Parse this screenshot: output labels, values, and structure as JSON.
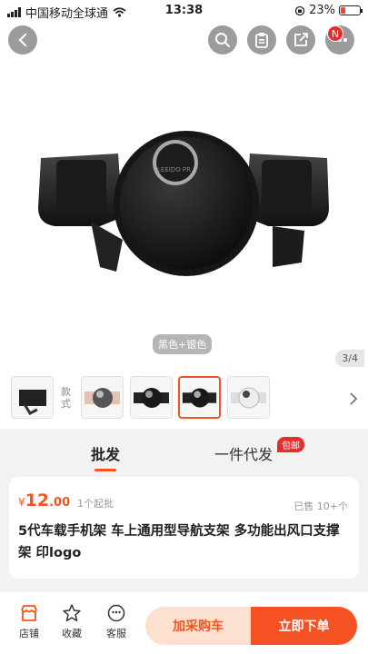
{
  "status": {
    "carrier": "中国移动全球通",
    "time": "13:38",
    "battery": "23%"
  },
  "header": {
    "badge": "N"
  },
  "gallery": {
    "color_tag": "黑色+银色",
    "page_indicator": "3/4",
    "brand_text": "LEEIDO PR"
  },
  "thumbs": {
    "style_label": "款式"
  },
  "tabs": [
    {
      "label": "批发"
    },
    {
      "label": "一件代发"
    }
  ],
  "tabs_badge": "包邮",
  "product": {
    "currency": "¥",
    "price_int": "12",
    "price_dec": ".00",
    "moq": "1个起批",
    "sold": "已售 10+个",
    "title": "5代车载手机架 车上通用型导航支架 多功能出风口支撑架 印logo"
  },
  "bottom": {
    "shop": "店铺",
    "fav": "收藏",
    "service": "客服",
    "add_cart": "加采购车",
    "buy_now": "立即下单"
  },
  "colors": {
    "accent": "#f45222",
    "badge_red": "#e62e2e"
  }
}
